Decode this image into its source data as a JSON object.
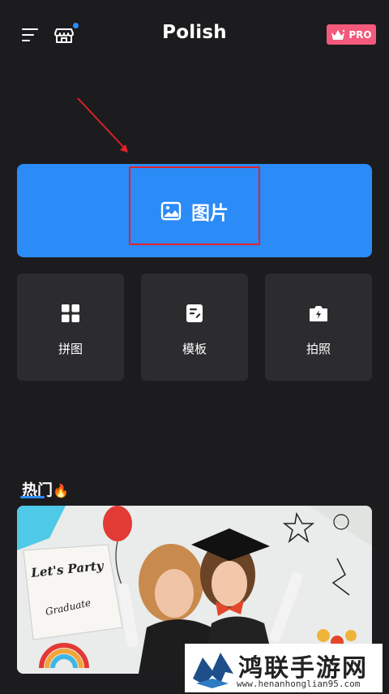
{
  "header": {
    "app_title": "Polish",
    "pro_label": "PRO",
    "icons": [
      "menu-icon",
      "store-icon",
      "crown-icon"
    ]
  },
  "main_action": {
    "label": "图片",
    "icon": "picture-icon"
  },
  "tools": [
    {
      "label": "拼图",
      "icon": "collage-icon"
    },
    {
      "label": "模板",
      "icon": "template-icon"
    },
    {
      "label": "拍照",
      "icon": "camera-icon"
    }
  ],
  "hot": {
    "title": "热门",
    "emoji": "🔥"
  },
  "banner": {
    "texts": [
      "Let's Party",
      "Graduate"
    ]
  },
  "watermark": {
    "title": "鸿联手游网",
    "url": "www.henanhonglian95.com"
  },
  "colors": {
    "background": "#1c1c1e",
    "primary": "#2b8bf7",
    "pro": "#f35a7b",
    "card": "#2c2c2f",
    "annotation": "#e3222a"
  }
}
